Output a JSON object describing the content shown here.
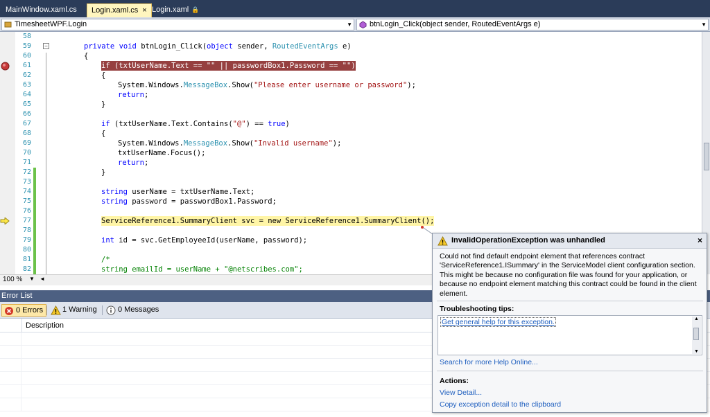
{
  "tabs": [
    {
      "label": "MainWindow.xaml.cs",
      "active": false
    },
    {
      "label": "Login.xaml.cs",
      "active": true,
      "close": "×"
    },
    {
      "label": "Login.xaml",
      "active": false,
      "lock": "🔒"
    }
  ],
  "nav": {
    "class_combo": "TimesheetWPF.Login",
    "member_combo": "btnLogin_Click(object sender, RoutedEventArgs e)"
  },
  "editor": {
    "line_numbers": [
      "58",
      "59",
      "60",
      "61",
      "62",
      "63",
      "64",
      "65",
      "66",
      "67",
      "68",
      "69",
      "70",
      "71",
      "72",
      "73",
      "74",
      "75",
      "76",
      "77",
      "78",
      "79",
      "80",
      "81",
      "82"
    ],
    "lines": {
      "l59": {
        "a": "private void ",
        "b": "btnLogin_Click(",
        "c": "object",
        "d": " sender, ",
        "e": "RoutedEventArgs",
        "f": " e)"
      },
      "l60": "{",
      "l61": "if (txtUserName.Text == \"\" || passwordBox1.Password == \"\")",
      "l62": "{",
      "l63": {
        "a": "System.Windows.",
        "b": "MessageBox",
        "c": ".Show(",
        "d": "\"Please enter username or password\"",
        "e": ");"
      },
      "l64": {
        "a": "return",
        "b": ";"
      },
      "l65": "}",
      "l67": {
        "a": "if",
        "b": " (txtUserName.Text.Contains(",
        "c": "\"@\"",
        "d": ") == ",
        "e": "true",
        "f": ")"
      },
      "l68": "{",
      "l69": {
        "a": "System.Windows.",
        "b": "MessageBox",
        "c": ".Show(",
        "d": "\"Invalid username\"",
        "e": ");"
      },
      "l70": "txtUserName.Focus();",
      "l71": {
        "a": "return",
        "b": ";"
      },
      "l72": "}",
      "l74": {
        "a": "string",
        "b": " userName = txtUserName.Text;"
      },
      "l75": {
        "a": "string",
        "b": " password = passwordBox1.Password;"
      },
      "l77": "ServiceReference1.SummaryClient svc = new ServiceReference1.SummaryClient();",
      "l79": {
        "a": "int",
        "b": " id = svc.GetEmployeeId(userName, password);"
      },
      "l81": "/*",
      "l82": {
        "a": "string",
        "b": " emailId = userName + ",
        "c": "\"@netscribes.com\"",
        "d": ";"
      }
    },
    "zoom": "100 %"
  },
  "error_list": {
    "title": "Error List",
    "errors": "0 Errors",
    "warnings": "1 Warning",
    "messages": "0 Messages",
    "col_description": "Description"
  },
  "exception": {
    "title": "InvalidOperationException was unhandled",
    "message": "Could not find default endpoint element that references contract 'ServiceReference1.ISummary' in the ServiceModel client configuration section. This might be because no configuration file was found for your application, or because no endpoint element matching this contract could be found in the client element.",
    "tips_heading": "Troubleshooting tips:",
    "tip_link": "Get general help for this exception.",
    "search_link": "Search for more Help Online...",
    "actions_heading": "Actions:",
    "view_detail": "View Detail...",
    "copy_detail": "Copy exception detail to the clipboard",
    "close": "×"
  },
  "colors": {
    "breakpoint": "#964040",
    "current_statement": "#fff5a6",
    "keyword": "#0000ff",
    "type": "#2b91af",
    "string": "#a31515"
  }
}
